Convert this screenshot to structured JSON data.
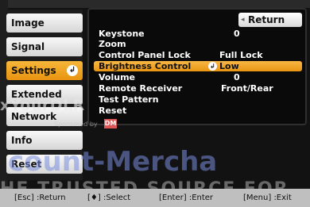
{
  "nav": {
    "items": [
      {
        "label": "Image",
        "selected": false
      },
      {
        "label": "Signal",
        "selected": false
      },
      {
        "label": "Settings",
        "selected": true
      },
      {
        "label": "Extended",
        "selected": false
      },
      {
        "label": "Network",
        "selected": false
      },
      {
        "label": "Info",
        "selected": false
      },
      {
        "label": "Reset",
        "selected": false
      }
    ],
    "enter_icon": "enter-icon"
  },
  "panel": {
    "return_label": "Return",
    "rows": [
      {
        "label": "Keystone",
        "value": "0"
      },
      {
        "label": "Zoom",
        "value": ""
      },
      {
        "label": "Control Panel Lock",
        "value": "Full Lock"
      },
      {
        "label": "Brightness Control",
        "value": "Low",
        "selected": true
      },
      {
        "label": "Volume",
        "value": "0"
      },
      {
        "label": "Remote Receiver",
        "value": "Front/Rear"
      },
      {
        "label": "Test Pattern",
        "value": ""
      },
      {
        "label": "Reset",
        "value": ""
      }
    ]
  },
  "footer": {
    "hints": [
      "[Esc] :Return",
      "[♦] :Select",
      "[Enter] :Enter",
      "[Menu] :Exit"
    ]
  },
  "watermarks": {
    "line1": "xYourDLR",
    "sponsored": "Sponsored by",
    "badge": "DM",
    "line2": "count-Mercha",
    "line3": "HE TRUSTED SOURCE FOR"
  },
  "colors": {
    "accent": "#f0a020",
    "panel_bg": "#0a0a0a",
    "nav_button": "#e6e6e6"
  }
}
